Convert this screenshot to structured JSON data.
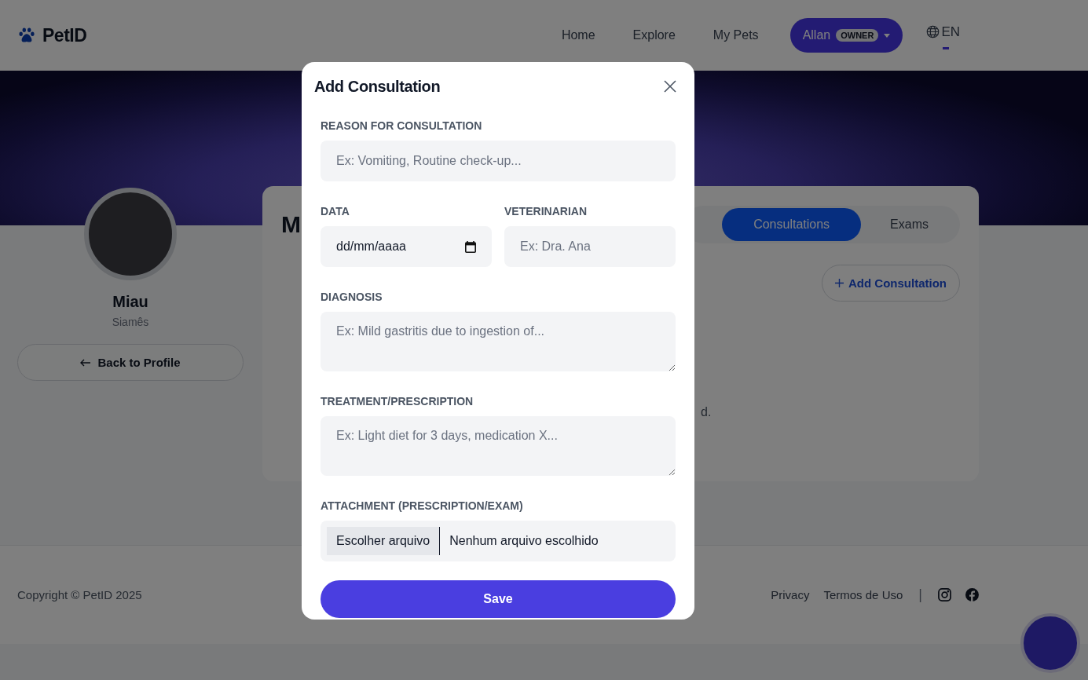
{
  "header": {
    "logo": "PetID",
    "nav": [
      {
        "label": "Home"
      },
      {
        "label": "Explore"
      },
      {
        "label": "My Pets"
      }
    ],
    "user": {
      "name": "Allan",
      "role": "OWNER"
    },
    "language": "EN"
  },
  "pet": {
    "name": "Miau",
    "breed": "Siamês",
    "back_button": "Back to Profile"
  },
  "card": {
    "title": "M",
    "tabs": [
      {
        "label": "Consultations",
        "selected": true
      },
      {
        "label": "Exams",
        "selected": false
      }
    ],
    "add_button": "Add Consultation",
    "empty_text": "d."
  },
  "footer": {
    "copyright": "Copyright © PetID 2025",
    "links": [
      {
        "label": "Privacy"
      },
      {
        "label": "Termos de Uso"
      }
    ],
    "separator": "|"
  },
  "modal": {
    "title": "Add Consultation",
    "rows": [
      [
        {
          "kind": "text",
          "label": "REASON FOR CONSULTATION",
          "placeholder": "Ex: Vomiting, Routine check-up..."
        }
      ],
      [
        {
          "kind": "date",
          "label": "DATA",
          "value": "dd/mm/aaaa"
        },
        {
          "kind": "text",
          "label": "VETERINARIAN",
          "placeholder": "Ex: Dra. Ana"
        }
      ],
      [
        {
          "kind": "textarea",
          "label": "DIAGNOSIS",
          "placeholder": "Ex: Mild gastritis due to ingestion of..."
        }
      ],
      [
        {
          "kind": "textarea",
          "label": "TREATMENT/PRESCRIPTION",
          "placeholder": "Ex: Light diet for 3 days, medication X..."
        }
      ],
      [
        {
          "kind": "file",
          "label": "ATTACHMENT (PRESCRIPTION/EXAM)",
          "button": "Escolher arquivo",
          "value": "Nenhum arquivo escolhido"
        }
      ]
    ],
    "save_button": "Save"
  }
}
